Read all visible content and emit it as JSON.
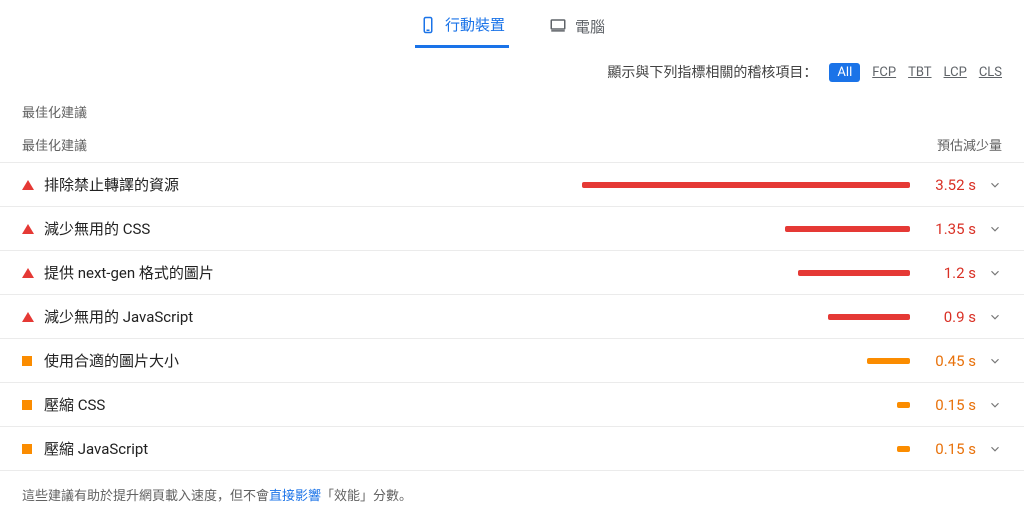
{
  "tabs": {
    "mobile": "行動裝置",
    "desktop": "電腦"
  },
  "filter": {
    "label": "顯示與下列指標相關的稽核項目：",
    "chips": {
      "all": "All",
      "fcp": "FCP",
      "tbt": "TBT",
      "lcp": "LCP",
      "cls": "CLS"
    }
  },
  "section_title": "最佳化建議",
  "columns": {
    "name": "最佳化建議",
    "savings": "預估減少量"
  },
  "opportunities": [
    {
      "label": "排除禁止轉譯的資源",
      "savings": "3.52 s",
      "severity": "red",
      "bar_pct": 100
    },
    {
      "label": "減少無用的 CSS",
      "savings": "1.35 s",
      "severity": "red",
      "bar_pct": 38
    },
    {
      "label": "提供 next-gen 格式的圖片",
      "savings": "1.2 s",
      "severity": "red",
      "bar_pct": 34
    },
    {
      "label": "減少無用的 JavaScript",
      "savings": "0.9 s",
      "severity": "red",
      "bar_pct": 25
    },
    {
      "label": "使用合適的圖片大小",
      "savings": "0.45 s",
      "severity": "orange",
      "bar_pct": 13
    },
    {
      "label": "壓縮 CSS",
      "savings": "0.15 s",
      "severity": "orange",
      "bar_pct": 4
    },
    {
      "label": "壓縮 JavaScript",
      "savings": "0.15 s",
      "severity": "orange",
      "bar_pct": 4
    }
  ],
  "footnote": {
    "pre": "這些建議有助於提升網頁載入速度，但不會",
    "link": "直接影響",
    "post": "「效能」分數。"
  }
}
